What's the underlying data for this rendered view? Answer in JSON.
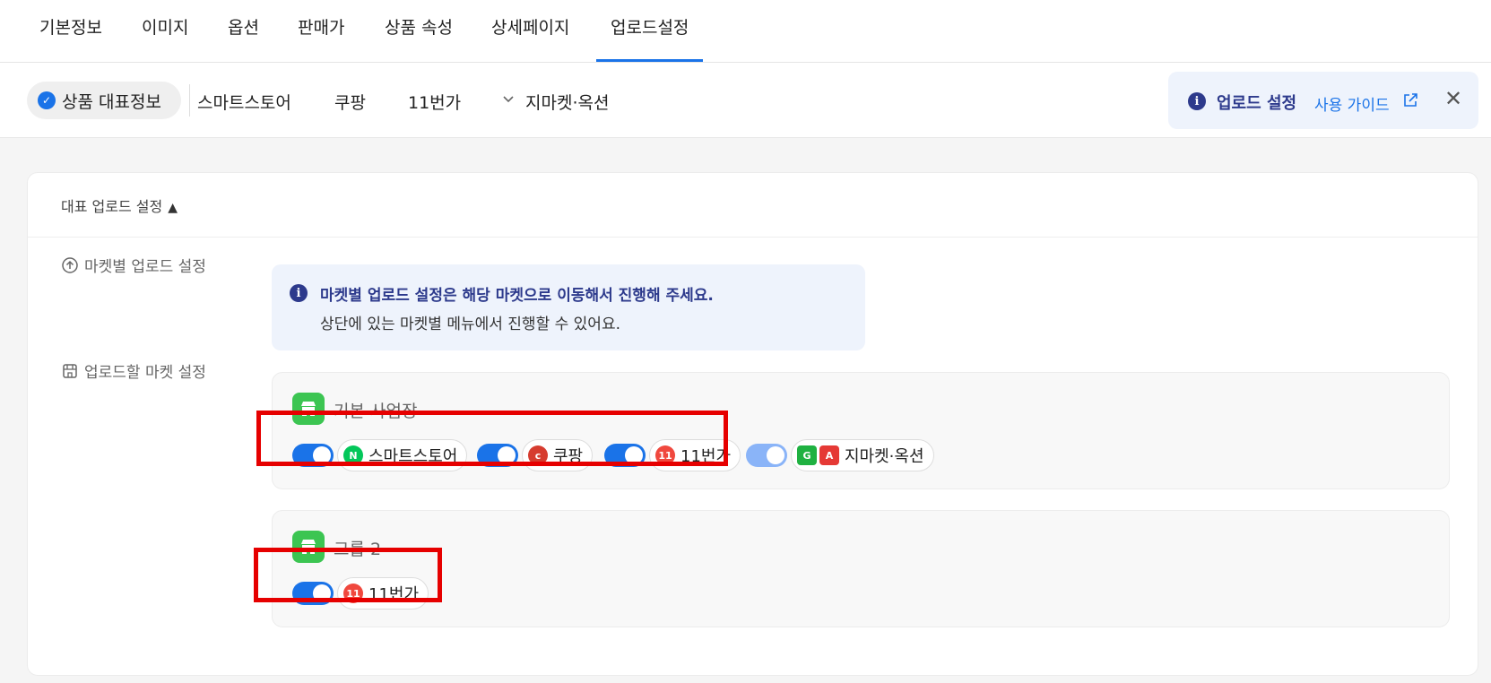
{
  "top_tabs": [
    "기본정보",
    "이미지",
    "옵션",
    "판매가",
    "상품 속성",
    "상세페이지",
    "업로드설정"
  ],
  "sub_nav": {
    "active": "상품 대표정보",
    "items": [
      "스마트스토어",
      "쿠팡",
      "11번가",
      "지마켓·옥션"
    ]
  },
  "guide": {
    "title": "업로드 설정",
    "link": "사용 가이드",
    "close": "✕"
  },
  "card": {
    "title": "대표 업로드 설정",
    "marketplace_label": "마켓별 업로드 설정",
    "info_line1": "마켓별 업로드 설정은 해당 마켓으로 이동해서 진행해 주세요.",
    "info_line2": "상단에 있는 마켓별 메뉴에서 진행할 수 있어요.",
    "target_label": "업로드할 마켓 설정"
  },
  "groups": [
    {
      "name": "기본 사업장",
      "markets": [
        {
          "name": "스마트스토어",
          "enabled": true
        },
        {
          "name": "쿠팡",
          "enabled": true
        },
        {
          "name": "11번가",
          "enabled": true
        },
        {
          "name": "지마켓·옥션",
          "enabled": true
        }
      ]
    },
    {
      "name": "그룹 2",
      "markets": [
        {
          "name": "11번가",
          "enabled": true
        }
      ]
    }
  ],
  "colors": {
    "accent": "#1a73e8",
    "info_text": "#2d3a8c",
    "highlight": "#e60000",
    "store_icon": "#3cc552"
  }
}
